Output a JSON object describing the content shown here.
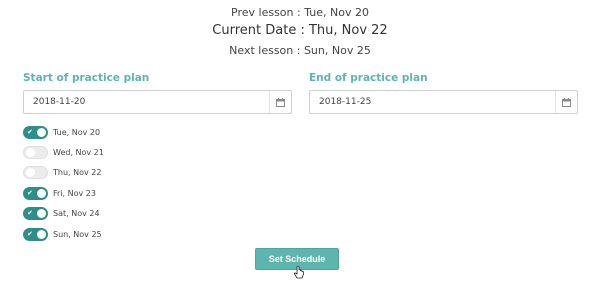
{
  "header": {
    "prev_lesson": "Prev lesson : Tue, Nov 20",
    "current_date": "Current Date : Thu, Nov 22",
    "next_lesson": "Next lesson : Sun, Nov 25"
  },
  "plan": {
    "start_label": "Start of practice plan",
    "start_value": "2018-11-20",
    "end_label": "End of practice plan",
    "end_value": "2018-11-25"
  },
  "days": [
    {
      "label": "Tue, Nov 20",
      "enabled": true
    },
    {
      "label": "Wed, Nov 21",
      "enabled": false
    },
    {
      "label": "Thu, Nov 22",
      "enabled": false
    },
    {
      "label": "Fri, Nov 23",
      "enabled": true
    },
    {
      "label": "Sat, Nov 24",
      "enabled": true
    },
    {
      "label": "Sun, Nov 25",
      "enabled": true
    }
  ],
  "actions": {
    "set_schedule_label": "Set Schedule"
  },
  "colors": {
    "accent": "#5db6ad",
    "toggle_on": "#2e8f86"
  }
}
